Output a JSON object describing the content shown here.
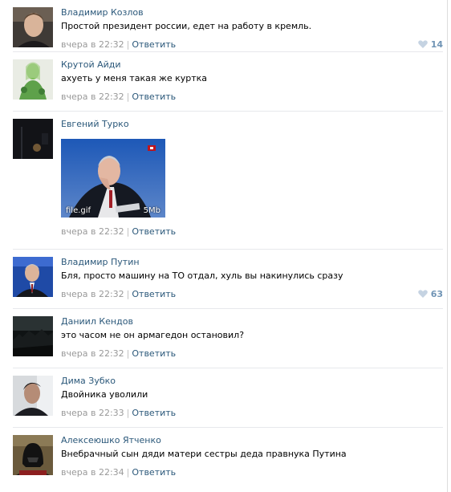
{
  "colors": {
    "link": "#2b587a",
    "meta": "#999999",
    "like": "#7094b5",
    "heart": "#c5d3e2",
    "divider": "#e7e8ec"
  },
  "comments": [
    {
      "author": "Владимир Козлов",
      "text": "Простой президент россии, едет на работу в кремль.",
      "time": "вчера в 22:32",
      "reply": "Ответить",
      "likes": "14",
      "avatar": "man-portrait-avatar"
    },
    {
      "author": "Крутой Айди",
      "text": "ахуеть у меня такая же куртка",
      "time": "вчера в 22:32",
      "reply": "Ответить",
      "likes": "",
      "avatar": "green-figure-avatar"
    },
    {
      "author": "Евгений Турко",
      "text": "",
      "time": "вчера в 22:32",
      "reply": "Ответить",
      "likes": "",
      "avatar": "dark-night-avatar",
      "attachment": {
        "name": "file.gif",
        "size": "5Mb"
      }
    },
    {
      "author": "Владимир Путин",
      "text": "Бля, просто машину на ТО отдал, хуль вы накинулись сразу",
      "time": "вчера в 22:32",
      "reply": "Ответить",
      "likes": "63",
      "avatar": "suited-man-avatar"
    },
    {
      "author": "Даниил Кендов",
      "text": "это часом не он армагедон остановил?",
      "time": "вчера в 22:32",
      "reply": "Ответить",
      "likes": "",
      "avatar": "dark-landscape-avatar"
    },
    {
      "author": "Дима Зубко",
      "text": "Двойника уволили",
      "time": "вчера в 22:33",
      "reply": "Ответить",
      "likes": "",
      "avatar": "man-dark-avatar"
    },
    {
      "author": "Алексеюшко Ятченко",
      "text": "Внебрачный сын дяди матери сестры деда правнука Путина",
      "time": "вчера в 22:34",
      "reply": "Ответить",
      "likes": "",
      "avatar": "helmet-avatar"
    }
  ]
}
